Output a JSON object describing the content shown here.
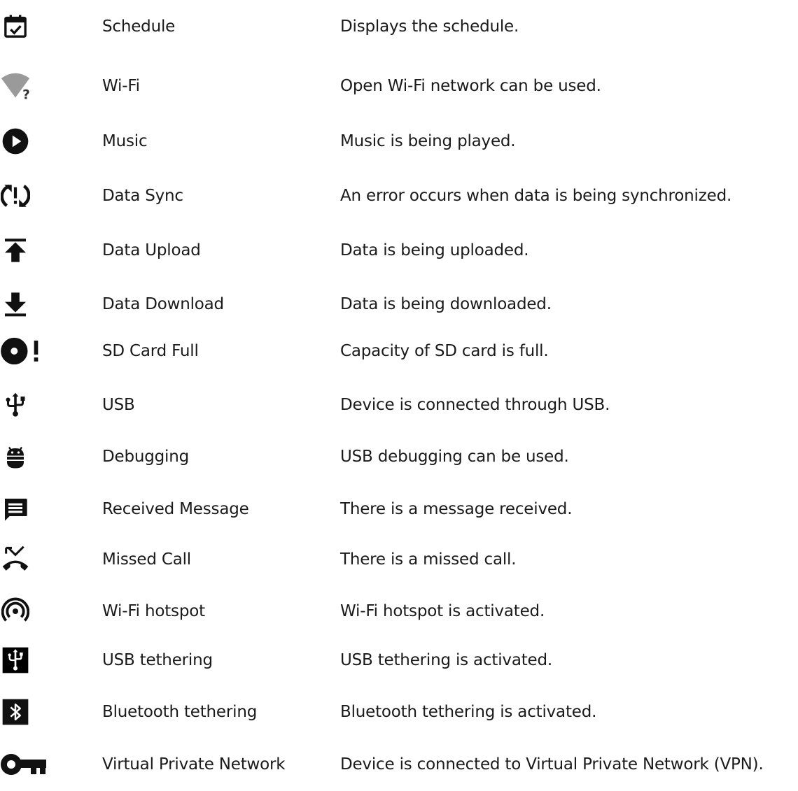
{
  "rows": [
    {
      "icon": "calendar-check-icon",
      "name": "Schedule",
      "description": "Displays the schedule."
    },
    {
      "icon": "wifi-question-icon",
      "name": "Wi-Fi",
      "description": "Open Wi-Fi network can be used."
    },
    {
      "icon": "play-circle-icon",
      "name": "Music",
      "description": "Music is being played."
    },
    {
      "icon": "sync-error-icon",
      "name": "Data Sync",
      "description": "An error occurs when data is being synchronized."
    },
    {
      "icon": "upload-icon",
      "name": "Data Upload",
      "description": "Data is being uploaded."
    },
    {
      "icon": "download-icon",
      "name": "Data Download",
      "description": "Data is being downloaded."
    },
    {
      "icon": "sd-card-full-icon",
      "name": "SD Card Full",
      "description": "Capacity of SD card is full."
    },
    {
      "icon": "usb-icon",
      "name": "USB",
      "description": "Device is connected through USB."
    },
    {
      "icon": "android-debug-icon",
      "name": "Debugging",
      "description": "USB debugging can be used."
    },
    {
      "icon": "message-icon",
      "name": "Received Message",
      "description": "There is a message received."
    },
    {
      "icon": "missed-call-icon",
      "name": "Missed Call",
      "description": "There is a missed call."
    },
    {
      "icon": "wifi-hotspot-icon",
      "name": "Wi-Fi hotspot",
      "description": "Wi-Fi hotspot is activated."
    },
    {
      "icon": "usb-tethering-icon",
      "name": "USB tethering",
      "description": "USB tethering is activated."
    },
    {
      "icon": "bluetooth-tethering-icon",
      "name": "Bluetooth tethering",
      "description": "Bluetooth tethering is activated."
    },
    {
      "icon": "vpn-key-icon",
      "name": "Virtual Private Network",
      "description": "Device is connected to Virtual Private Network (VPN)."
    }
  ]
}
